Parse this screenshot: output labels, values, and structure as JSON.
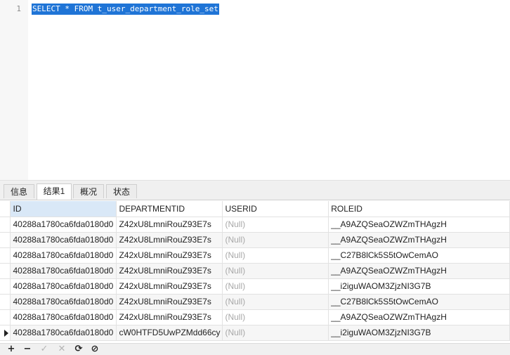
{
  "editor": {
    "line_number": "1",
    "sql": "SELECT * FROM t_user_department_role_set"
  },
  "tabs": [
    {
      "label": "信息"
    },
    {
      "label": "结果1"
    },
    {
      "label": "概况"
    },
    {
      "label": "状态"
    }
  ],
  "grid": {
    "columns": [
      "ID",
      "DEPARTMENTID",
      "USERID",
      "ROLEID"
    ],
    "rows": [
      [
        "40288a1780ca6fda0180d0",
        "Z42xU8LmniRouZ93E7s",
        "(Null)",
        "__A9AZQSeaOZWZmTHAgzH"
      ],
      [
        "40288a1780ca6fda0180d0",
        "Z42xU8LmniRouZ93E7s",
        "(Null)",
        "__A9AZQSeaOZWZmTHAgzH"
      ],
      [
        "40288a1780ca6fda0180d0",
        "Z42xU8LmniRouZ93E7s",
        "(Null)",
        "__C27B8lCk5S5tOwCemAO"
      ],
      [
        "40288a1780ca6fda0180d0",
        "Z42xU8LmniRouZ93E7s",
        "(Null)",
        "__A9AZQSeaOZWZmTHAgzH"
      ],
      [
        "40288a1780ca6fda0180d0",
        "Z42xU8LmniRouZ93E7s",
        "(Null)",
        "__i2iguWAOM3ZjzNI3G7B"
      ],
      [
        "40288a1780ca6fda0180d0",
        "Z42xU8LmniRouZ93E7s",
        "(Null)",
        "__C27B8lCk5S5tOwCemAO"
      ],
      [
        "40288a1780ca6fda0180d0",
        "Z42xU8LmniRouZ93E7s",
        "(Null)",
        "__A9AZQSeaOZWZmTHAgzH"
      ],
      [
        "40288a1780ca6fda0180d0",
        "cW0HTFD5UwPZMdd66cy",
        "(Null)",
        "__i2iguWAOM3ZjzNI3G7B"
      ]
    ]
  },
  "toolbar": {
    "add": "+",
    "remove": "−",
    "apply": "✓",
    "discard": "✕",
    "refresh": "⟳",
    "stop": "⊘"
  }
}
